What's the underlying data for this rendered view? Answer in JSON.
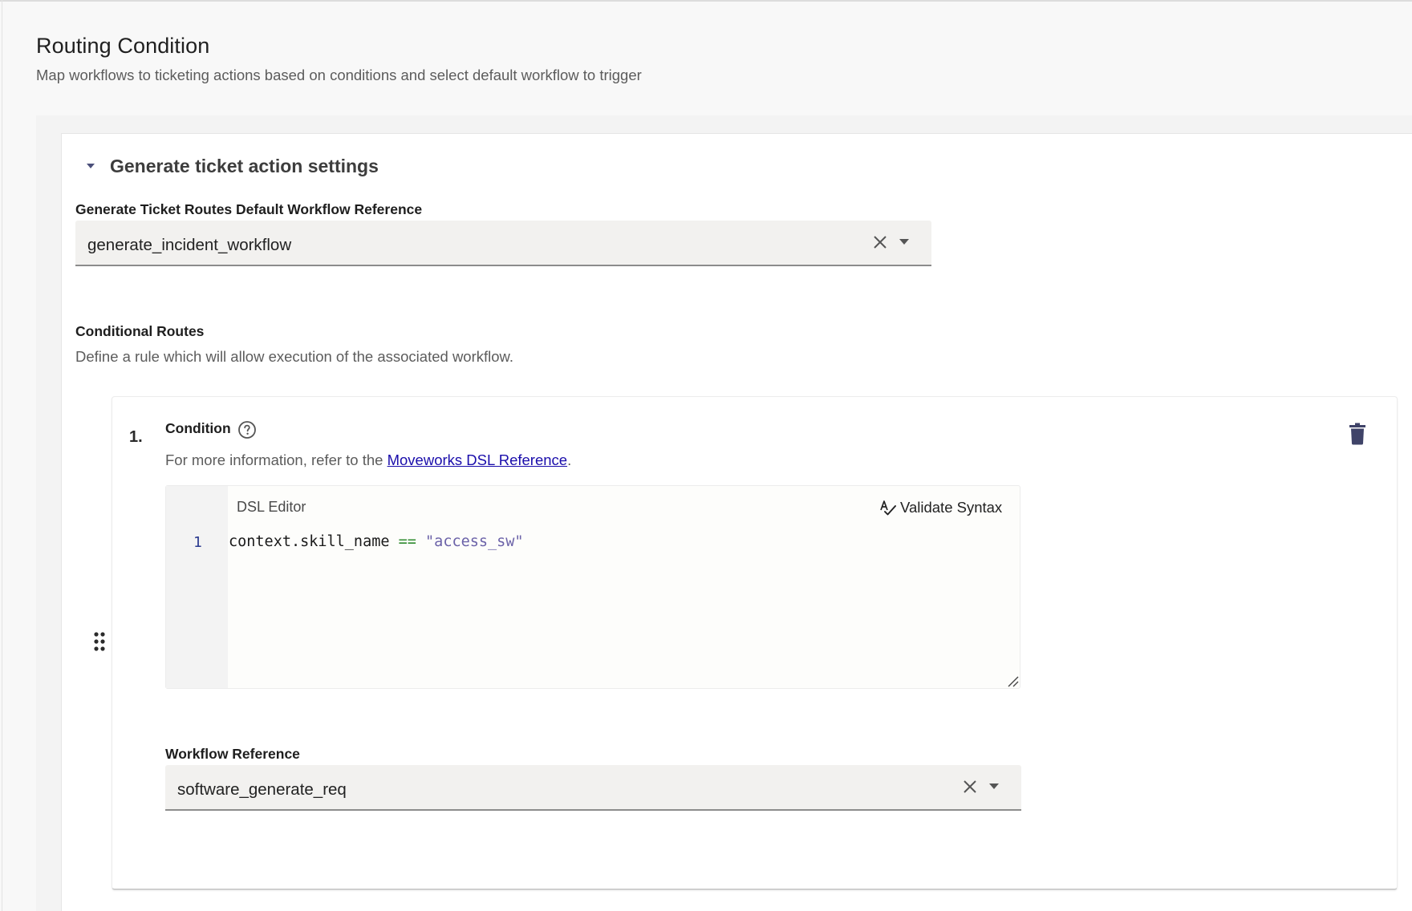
{
  "header": {
    "title": "Routing Condition",
    "subtitle": "Map workflows to ticketing actions based on conditions and select default workflow to trigger"
  },
  "section": {
    "title": "Generate ticket action settings",
    "expanded": true
  },
  "default_workflow": {
    "label": "Generate Ticket Routes Default Workflow Reference",
    "value": "generate_incident_workflow"
  },
  "conditional_routes": {
    "heading": "Conditional Routes",
    "description": "Define a rule which will allow execution of the associated workflow.",
    "routes": [
      {
        "index": "1.",
        "condition_label": "Condition",
        "info_prefix": "For more information, refer to the ",
        "info_link": "Moveworks DSL Reference",
        "info_suffix": ".",
        "editor": {
          "title": "DSL Editor",
          "validate_label": "Validate Syntax",
          "line_number": "1",
          "code_ident": "context.skill_name",
          "code_op": "==",
          "code_string": "\"access_sw\""
        },
        "workflow_label": "Workflow Reference",
        "workflow_value": "software_generate_req"
      }
    ]
  },
  "colors": {
    "link": "#1a0dab",
    "delete_icon": "#3f4368",
    "line_number": "#2b3a8f",
    "code_operator": "#2e8a2e",
    "code_string": "#6b62a8"
  }
}
